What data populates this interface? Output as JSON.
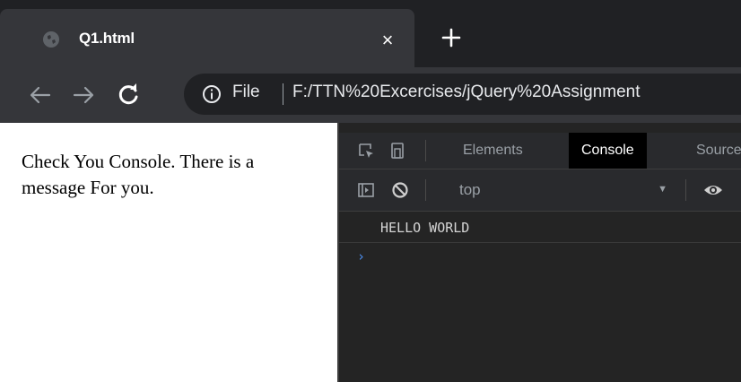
{
  "browser": {
    "tab": {
      "title": "Q1.html",
      "close_glyph": "×",
      "favicon": "globe-icon"
    },
    "new_tab_glyph": "+",
    "toolbar": {
      "back_icon": "arrow-left-icon",
      "forward_icon": "arrow-right-icon",
      "reload_icon": "reload-icon",
      "site_info_icon": "info-icon",
      "scheme_label": "File",
      "url": "F:/TTN%20Excercises/jQuery%20Assignment"
    }
  },
  "page": {
    "text": "Check You Console. There is a message For you."
  },
  "devtools": {
    "tabs": [
      {
        "label": "Elements",
        "active": false
      },
      {
        "label": "Console",
        "active": true
      },
      {
        "label": "Sources",
        "active": false
      }
    ],
    "console_toolbar": {
      "context": "top"
    },
    "messages": [
      "HELLO WORLD"
    ],
    "prompt_glyph": "›"
  },
  "colors": {
    "frame": "#202124",
    "toolbar": "#35363a",
    "devtools_bg": "#242424",
    "accent_prompt": "#4d8ff0"
  }
}
